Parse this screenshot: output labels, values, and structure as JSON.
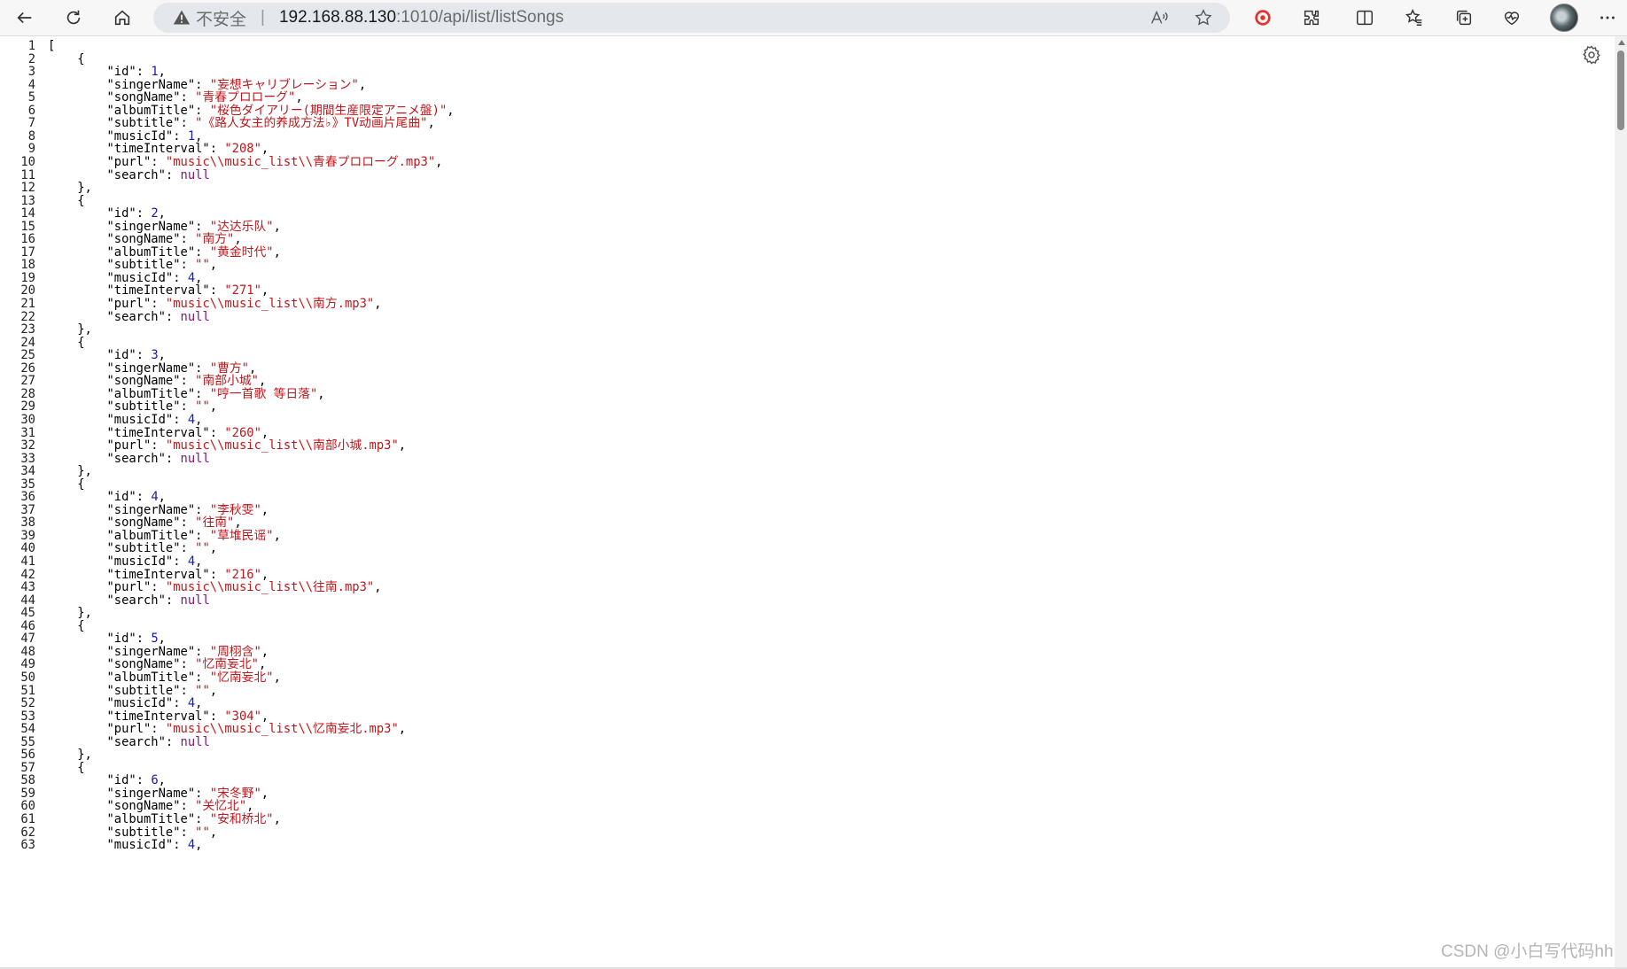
{
  "browser": {
    "security_label": "不安全",
    "address_separator": "|",
    "url_host": "192.168.88.130",
    "url_rest": ":1010/api/list/listSongs"
  },
  "json_lines": [
    [
      {
        "t": "p",
        "v": "["
      }
    ],
    [
      {
        "t": "p",
        "v": "    {"
      }
    ],
    [
      {
        "t": "p",
        "v": "        "
      },
      {
        "t": "k",
        "v": "\"id\""
      },
      {
        "t": "p",
        "v": ": "
      },
      {
        "t": "n",
        "v": "1"
      },
      {
        "t": "p",
        "v": ","
      }
    ],
    [
      {
        "t": "p",
        "v": "        "
      },
      {
        "t": "k",
        "v": "\"singerName\""
      },
      {
        "t": "p",
        "v": ": "
      },
      {
        "t": "s",
        "v": "\"妄想キャリブレーション\""
      },
      {
        "t": "p",
        "v": ","
      }
    ],
    [
      {
        "t": "p",
        "v": "        "
      },
      {
        "t": "k",
        "v": "\"songName\""
      },
      {
        "t": "p",
        "v": ": "
      },
      {
        "t": "s",
        "v": "\"青春プロローグ\""
      },
      {
        "t": "p",
        "v": ","
      }
    ],
    [
      {
        "t": "p",
        "v": "        "
      },
      {
        "t": "k",
        "v": "\"albumTitle\""
      },
      {
        "t": "p",
        "v": ": "
      },
      {
        "t": "s",
        "v": "\"桜色ダイアリー(期間生産限定アニメ盤)\""
      },
      {
        "t": "p",
        "v": ","
      }
    ],
    [
      {
        "t": "p",
        "v": "        "
      },
      {
        "t": "k",
        "v": "\"subtitle\""
      },
      {
        "t": "p",
        "v": ": "
      },
      {
        "t": "s",
        "v": "\"《路人女主的养成方法♭》TV动画片尾曲\""
      },
      {
        "t": "p",
        "v": ","
      }
    ],
    [
      {
        "t": "p",
        "v": "        "
      },
      {
        "t": "k",
        "v": "\"musicId\""
      },
      {
        "t": "p",
        "v": ": "
      },
      {
        "t": "n",
        "v": "1"
      },
      {
        "t": "p",
        "v": ","
      }
    ],
    [
      {
        "t": "p",
        "v": "        "
      },
      {
        "t": "k",
        "v": "\"timeInterval\""
      },
      {
        "t": "p",
        "v": ": "
      },
      {
        "t": "s",
        "v": "\"208\""
      },
      {
        "t": "p",
        "v": ","
      }
    ],
    [
      {
        "t": "p",
        "v": "        "
      },
      {
        "t": "k",
        "v": "\"purl\""
      },
      {
        "t": "p",
        "v": ": "
      },
      {
        "t": "s",
        "v": "\"music\\\\music_list\\\\青春プロローグ.mp3\""
      },
      {
        "t": "p",
        "v": ","
      }
    ],
    [
      {
        "t": "p",
        "v": "        "
      },
      {
        "t": "k",
        "v": "\"search\""
      },
      {
        "t": "p",
        "v": ": "
      },
      {
        "t": "nl",
        "v": "null"
      }
    ],
    [
      {
        "t": "p",
        "v": "    },"
      }
    ],
    [
      {
        "t": "p",
        "v": "    {"
      }
    ],
    [
      {
        "t": "p",
        "v": "        "
      },
      {
        "t": "k",
        "v": "\"id\""
      },
      {
        "t": "p",
        "v": ": "
      },
      {
        "t": "n",
        "v": "2"
      },
      {
        "t": "p",
        "v": ","
      }
    ],
    [
      {
        "t": "p",
        "v": "        "
      },
      {
        "t": "k",
        "v": "\"singerName\""
      },
      {
        "t": "p",
        "v": ": "
      },
      {
        "t": "s",
        "v": "\"达达乐队\""
      },
      {
        "t": "p",
        "v": ","
      }
    ],
    [
      {
        "t": "p",
        "v": "        "
      },
      {
        "t": "k",
        "v": "\"songName\""
      },
      {
        "t": "p",
        "v": ": "
      },
      {
        "t": "s",
        "v": "\"南方\""
      },
      {
        "t": "p",
        "v": ","
      }
    ],
    [
      {
        "t": "p",
        "v": "        "
      },
      {
        "t": "k",
        "v": "\"albumTitle\""
      },
      {
        "t": "p",
        "v": ": "
      },
      {
        "t": "s",
        "v": "\"黄金时代\""
      },
      {
        "t": "p",
        "v": ","
      }
    ],
    [
      {
        "t": "p",
        "v": "        "
      },
      {
        "t": "k",
        "v": "\"subtitle\""
      },
      {
        "t": "p",
        "v": ": "
      },
      {
        "t": "s",
        "v": "\"\""
      },
      {
        "t": "p",
        "v": ","
      }
    ],
    [
      {
        "t": "p",
        "v": "        "
      },
      {
        "t": "k",
        "v": "\"musicId\""
      },
      {
        "t": "p",
        "v": ": "
      },
      {
        "t": "n",
        "v": "4"
      },
      {
        "t": "p",
        "v": ","
      }
    ],
    [
      {
        "t": "p",
        "v": "        "
      },
      {
        "t": "k",
        "v": "\"timeInterval\""
      },
      {
        "t": "p",
        "v": ": "
      },
      {
        "t": "s",
        "v": "\"271\""
      },
      {
        "t": "p",
        "v": ","
      }
    ],
    [
      {
        "t": "p",
        "v": "        "
      },
      {
        "t": "k",
        "v": "\"purl\""
      },
      {
        "t": "p",
        "v": ": "
      },
      {
        "t": "s",
        "v": "\"music\\\\music_list\\\\南方.mp3\""
      },
      {
        "t": "p",
        "v": ","
      }
    ],
    [
      {
        "t": "p",
        "v": "        "
      },
      {
        "t": "k",
        "v": "\"search\""
      },
      {
        "t": "p",
        "v": ": "
      },
      {
        "t": "nl",
        "v": "null"
      }
    ],
    [
      {
        "t": "p",
        "v": "    },"
      }
    ],
    [
      {
        "t": "p",
        "v": "    {"
      }
    ],
    [
      {
        "t": "p",
        "v": "        "
      },
      {
        "t": "k",
        "v": "\"id\""
      },
      {
        "t": "p",
        "v": ": "
      },
      {
        "t": "n",
        "v": "3"
      },
      {
        "t": "p",
        "v": ","
      }
    ],
    [
      {
        "t": "p",
        "v": "        "
      },
      {
        "t": "k",
        "v": "\"singerName\""
      },
      {
        "t": "p",
        "v": ": "
      },
      {
        "t": "s",
        "v": "\"曹方\""
      },
      {
        "t": "p",
        "v": ","
      }
    ],
    [
      {
        "t": "p",
        "v": "        "
      },
      {
        "t": "k",
        "v": "\"songName\""
      },
      {
        "t": "p",
        "v": ": "
      },
      {
        "t": "s",
        "v": "\"南部小城\""
      },
      {
        "t": "p",
        "v": ","
      }
    ],
    [
      {
        "t": "p",
        "v": "        "
      },
      {
        "t": "k",
        "v": "\"albumTitle\""
      },
      {
        "t": "p",
        "v": ": "
      },
      {
        "t": "s",
        "v": "\"哼一首歌 等日落\""
      },
      {
        "t": "p",
        "v": ","
      }
    ],
    [
      {
        "t": "p",
        "v": "        "
      },
      {
        "t": "k",
        "v": "\"subtitle\""
      },
      {
        "t": "p",
        "v": ": "
      },
      {
        "t": "s",
        "v": "\"\""
      },
      {
        "t": "p",
        "v": ","
      }
    ],
    [
      {
        "t": "p",
        "v": "        "
      },
      {
        "t": "k",
        "v": "\"musicId\""
      },
      {
        "t": "p",
        "v": ": "
      },
      {
        "t": "n",
        "v": "4"
      },
      {
        "t": "p",
        "v": ","
      }
    ],
    [
      {
        "t": "p",
        "v": "        "
      },
      {
        "t": "k",
        "v": "\"timeInterval\""
      },
      {
        "t": "p",
        "v": ": "
      },
      {
        "t": "s",
        "v": "\"260\""
      },
      {
        "t": "p",
        "v": ","
      }
    ],
    [
      {
        "t": "p",
        "v": "        "
      },
      {
        "t": "k",
        "v": "\"purl\""
      },
      {
        "t": "p",
        "v": ": "
      },
      {
        "t": "s",
        "v": "\"music\\\\music_list\\\\南部小城.mp3\""
      },
      {
        "t": "p",
        "v": ","
      }
    ],
    [
      {
        "t": "p",
        "v": "        "
      },
      {
        "t": "k",
        "v": "\"search\""
      },
      {
        "t": "p",
        "v": ": "
      },
      {
        "t": "nl",
        "v": "null"
      }
    ],
    [
      {
        "t": "p",
        "v": "    },"
      }
    ],
    [
      {
        "t": "p",
        "v": "    {"
      }
    ],
    [
      {
        "t": "p",
        "v": "        "
      },
      {
        "t": "k",
        "v": "\"id\""
      },
      {
        "t": "p",
        "v": ": "
      },
      {
        "t": "n",
        "v": "4"
      },
      {
        "t": "p",
        "v": ","
      }
    ],
    [
      {
        "t": "p",
        "v": "        "
      },
      {
        "t": "k",
        "v": "\"singerName\""
      },
      {
        "t": "p",
        "v": ": "
      },
      {
        "t": "s",
        "v": "\"李秋雯\""
      },
      {
        "t": "p",
        "v": ","
      }
    ],
    [
      {
        "t": "p",
        "v": "        "
      },
      {
        "t": "k",
        "v": "\"songName\""
      },
      {
        "t": "p",
        "v": ": "
      },
      {
        "t": "s",
        "v": "\"往南\""
      },
      {
        "t": "p",
        "v": ","
      }
    ],
    [
      {
        "t": "p",
        "v": "        "
      },
      {
        "t": "k",
        "v": "\"albumTitle\""
      },
      {
        "t": "p",
        "v": ": "
      },
      {
        "t": "s",
        "v": "\"草堆民谣\""
      },
      {
        "t": "p",
        "v": ","
      }
    ],
    [
      {
        "t": "p",
        "v": "        "
      },
      {
        "t": "k",
        "v": "\"subtitle\""
      },
      {
        "t": "p",
        "v": ": "
      },
      {
        "t": "s",
        "v": "\"\""
      },
      {
        "t": "p",
        "v": ","
      }
    ],
    [
      {
        "t": "p",
        "v": "        "
      },
      {
        "t": "k",
        "v": "\"musicId\""
      },
      {
        "t": "p",
        "v": ": "
      },
      {
        "t": "n",
        "v": "4"
      },
      {
        "t": "p",
        "v": ","
      }
    ],
    [
      {
        "t": "p",
        "v": "        "
      },
      {
        "t": "k",
        "v": "\"timeInterval\""
      },
      {
        "t": "p",
        "v": ": "
      },
      {
        "t": "s",
        "v": "\"216\""
      },
      {
        "t": "p",
        "v": ","
      }
    ],
    [
      {
        "t": "p",
        "v": "        "
      },
      {
        "t": "k",
        "v": "\"purl\""
      },
      {
        "t": "p",
        "v": ": "
      },
      {
        "t": "s",
        "v": "\"music\\\\music_list\\\\往南.mp3\""
      },
      {
        "t": "p",
        "v": ","
      }
    ],
    [
      {
        "t": "p",
        "v": "        "
      },
      {
        "t": "k",
        "v": "\"search\""
      },
      {
        "t": "p",
        "v": ": "
      },
      {
        "t": "nl",
        "v": "null"
      }
    ],
    [
      {
        "t": "p",
        "v": "    },"
      }
    ],
    [
      {
        "t": "p",
        "v": "    {"
      }
    ],
    [
      {
        "t": "p",
        "v": "        "
      },
      {
        "t": "k",
        "v": "\"id\""
      },
      {
        "t": "p",
        "v": ": "
      },
      {
        "t": "n",
        "v": "5"
      },
      {
        "t": "p",
        "v": ","
      }
    ],
    [
      {
        "t": "p",
        "v": "        "
      },
      {
        "t": "k",
        "v": "\"singerName\""
      },
      {
        "t": "p",
        "v": ": "
      },
      {
        "t": "s",
        "v": "\"周栩含\""
      },
      {
        "t": "p",
        "v": ","
      }
    ],
    [
      {
        "t": "p",
        "v": "        "
      },
      {
        "t": "k",
        "v": "\"songName\""
      },
      {
        "t": "p",
        "v": ": "
      },
      {
        "t": "s",
        "v": "\"忆南妄北\""
      },
      {
        "t": "p",
        "v": ","
      }
    ],
    [
      {
        "t": "p",
        "v": "        "
      },
      {
        "t": "k",
        "v": "\"albumTitle\""
      },
      {
        "t": "p",
        "v": ": "
      },
      {
        "t": "s",
        "v": "\"忆南妄北\""
      },
      {
        "t": "p",
        "v": ","
      }
    ],
    [
      {
        "t": "p",
        "v": "        "
      },
      {
        "t": "k",
        "v": "\"subtitle\""
      },
      {
        "t": "p",
        "v": ": "
      },
      {
        "t": "s",
        "v": "\"\""
      },
      {
        "t": "p",
        "v": ","
      }
    ],
    [
      {
        "t": "p",
        "v": "        "
      },
      {
        "t": "k",
        "v": "\"musicId\""
      },
      {
        "t": "p",
        "v": ": "
      },
      {
        "t": "n",
        "v": "4"
      },
      {
        "t": "p",
        "v": ","
      }
    ],
    [
      {
        "t": "p",
        "v": "        "
      },
      {
        "t": "k",
        "v": "\"timeInterval\""
      },
      {
        "t": "p",
        "v": ": "
      },
      {
        "t": "s",
        "v": "\"304\""
      },
      {
        "t": "p",
        "v": ","
      }
    ],
    [
      {
        "t": "p",
        "v": "        "
      },
      {
        "t": "k",
        "v": "\"purl\""
      },
      {
        "t": "p",
        "v": ": "
      },
      {
        "t": "s",
        "v": "\"music\\\\music_list\\\\忆南妄北.mp3\""
      },
      {
        "t": "p",
        "v": ","
      }
    ],
    [
      {
        "t": "p",
        "v": "        "
      },
      {
        "t": "k",
        "v": "\"search\""
      },
      {
        "t": "p",
        "v": ": "
      },
      {
        "t": "nl",
        "v": "null"
      }
    ],
    [
      {
        "t": "p",
        "v": "    },"
      }
    ],
    [
      {
        "t": "p",
        "v": "    {"
      }
    ],
    [
      {
        "t": "p",
        "v": "        "
      },
      {
        "t": "k",
        "v": "\"id\""
      },
      {
        "t": "p",
        "v": ": "
      },
      {
        "t": "n",
        "v": "6"
      },
      {
        "t": "p",
        "v": ","
      }
    ],
    [
      {
        "t": "p",
        "v": "        "
      },
      {
        "t": "k",
        "v": "\"singerName\""
      },
      {
        "t": "p",
        "v": ": "
      },
      {
        "t": "s",
        "v": "\"宋冬野\""
      },
      {
        "t": "p",
        "v": ","
      }
    ],
    [
      {
        "t": "p",
        "v": "        "
      },
      {
        "t": "k",
        "v": "\"songName\""
      },
      {
        "t": "p",
        "v": ": "
      },
      {
        "t": "s",
        "v": "\"关忆北\""
      },
      {
        "t": "p",
        "v": ","
      }
    ],
    [
      {
        "t": "p",
        "v": "        "
      },
      {
        "t": "k",
        "v": "\"albumTitle\""
      },
      {
        "t": "p",
        "v": ": "
      },
      {
        "t": "s",
        "v": "\"安和桥北\""
      },
      {
        "t": "p",
        "v": ","
      }
    ],
    [
      {
        "t": "p",
        "v": "        "
      },
      {
        "t": "k",
        "v": "\"subtitle\""
      },
      {
        "t": "p",
        "v": ": "
      },
      {
        "t": "s",
        "v": "\"\""
      },
      {
        "t": "p",
        "v": ","
      }
    ],
    [
      {
        "t": "p",
        "v": "        "
      },
      {
        "t": "k",
        "v": "\"musicId\""
      },
      {
        "t": "p",
        "v": ": "
      },
      {
        "t": "n",
        "v": "4"
      },
      {
        "t": "p",
        "v": ","
      }
    ]
  ],
  "watermark": "CSDN @小白写代码hh",
  "icons": [
    "back-arrow-icon",
    "refresh-icon",
    "home-icon",
    "warning-icon",
    "read-aloud-icon",
    "favorite-star-icon",
    "extension-red-icon",
    "extensions-icon",
    "split-screen-icon",
    "favorites-icon",
    "collections-icon",
    "performance-icon",
    "profile-avatar",
    "more-icon",
    "settings-gear-icon"
  ]
}
